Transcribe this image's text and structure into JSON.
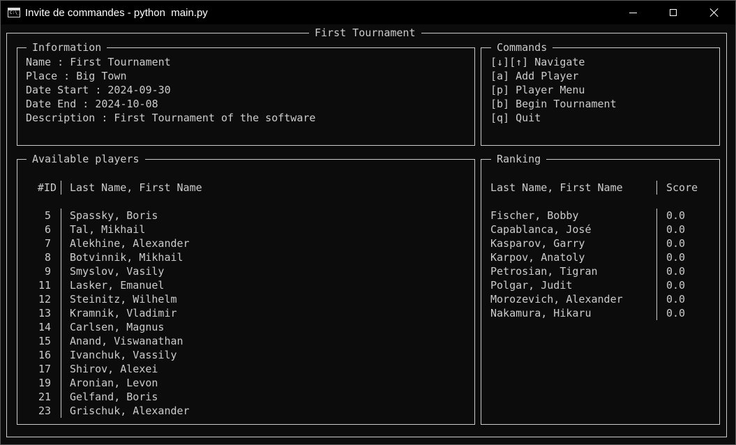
{
  "window": {
    "title": "Invite de commandes - python  main.py",
    "icon_label": "C:\\_"
  },
  "tournament_title": "First Tournament",
  "information": {
    "title": "Information",
    "lines": [
      "Name : First Tournament",
      "Place : Big Town",
      "Date Start : 2024-09-30",
      "Date End : 2024-10-08",
      "Description : First Tournament of the software"
    ]
  },
  "commands": {
    "title": "Commands",
    "items": [
      "[↓][↑] Navigate",
      "[a] Add Player",
      "[p] Player Menu",
      "[b] Begin Tournament",
      "[q] Quit"
    ]
  },
  "available_players": {
    "title": "Available players",
    "header_id": "#ID",
    "header_name": "Last Name, First Name",
    "rows": [
      {
        "id": "5",
        "name": "Spassky, Boris"
      },
      {
        "id": "6",
        "name": "Tal, Mikhail"
      },
      {
        "id": "7",
        "name": "Alekhine, Alexander"
      },
      {
        "id": "8",
        "name": "Botvinnik, Mikhail"
      },
      {
        "id": "9",
        "name": "Smyslov, Vasily"
      },
      {
        "id": "11",
        "name": "Lasker, Emanuel"
      },
      {
        "id": "12",
        "name": "Steinitz, Wilhelm"
      },
      {
        "id": "13",
        "name": "Kramnik, Vladimir"
      },
      {
        "id": "14",
        "name": "Carlsen, Magnus"
      },
      {
        "id": "15",
        "name": "Anand, Viswanathan"
      },
      {
        "id": "16",
        "name": "Ivanchuk, Vassily"
      },
      {
        "id": "17",
        "name": "Shirov, Alexei"
      },
      {
        "id": "19",
        "name": "Aronian, Levon"
      },
      {
        "id": "21",
        "name": "Gelfand, Boris"
      },
      {
        "id": "23",
        "name": "Grischuk, Alexander"
      }
    ]
  },
  "ranking": {
    "title": "Ranking",
    "header_name": "Last Name, First Name",
    "header_score": "Score",
    "rows": [
      {
        "name": "Fischer, Bobby",
        "score": "0.0"
      },
      {
        "name": "Capablanca, José",
        "score": "0.0"
      },
      {
        "name": "Kasparov, Garry",
        "score": "0.0"
      },
      {
        "name": "Karpov, Anatoly",
        "score": "0.0"
      },
      {
        "name": "Petrosian, Tigran",
        "score": "0.0"
      },
      {
        "name": "Polgar, Judit",
        "score": "0.0"
      },
      {
        "name": "Morozevich, Alexander",
        "score": "0.0"
      },
      {
        "name": "Nakamura, Hikaru",
        "score": "0.0"
      }
    ]
  },
  "colors": {
    "background": "#0c0c0c",
    "foreground": "#cccccc",
    "titlebar": "#000000"
  }
}
